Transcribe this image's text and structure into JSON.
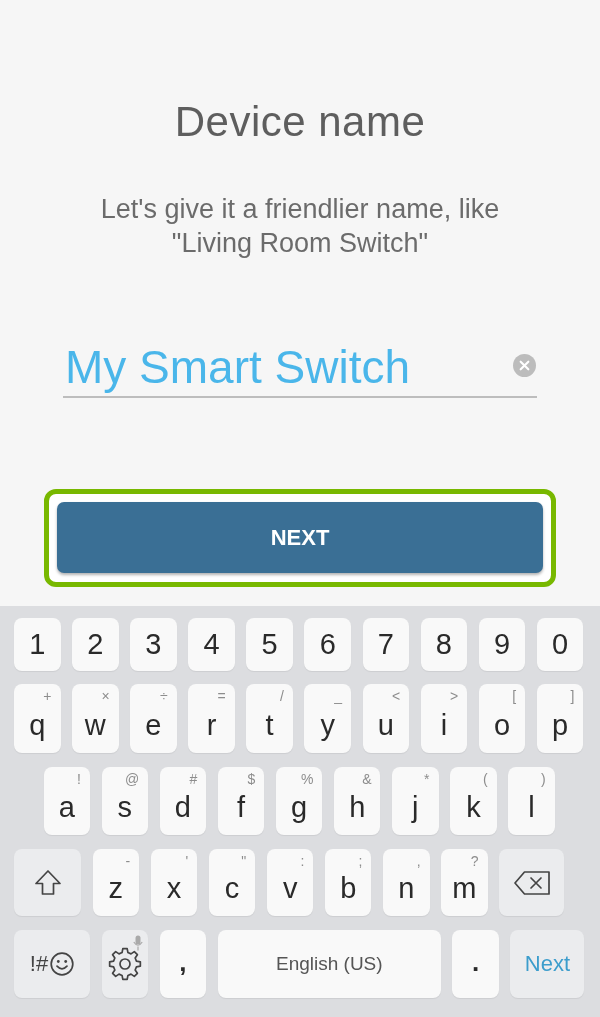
{
  "screen": {
    "title": "Device name",
    "subtitle": "Let's give it a friendlier name, like \"Living Room Switch\""
  },
  "name_field": {
    "value": "My Smart Switch"
  },
  "next_button": {
    "label": "NEXT",
    "highlighted": true
  },
  "keyboard": {
    "rows": [
      {
        "keys": [
          {
            "kind": "char",
            "label": "1"
          },
          {
            "kind": "char",
            "label": "2"
          },
          {
            "kind": "char",
            "label": "3"
          },
          {
            "kind": "char",
            "label": "4"
          },
          {
            "kind": "char",
            "label": "5"
          },
          {
            "kind": "char",
            "label": "6"
          },
          {
            "kind": "char",
            "label": "7"
          },
          {
            "kind": "char",
            "label": "8"
          },
          {
            "kind": "char",
            "label": "9"
          },
          {
            "kind": "char",
            "label": "0"
          }
        ]
      },
      {
        "keys": [
          {
            "kind": "char",
            "label": "q",
            "hint": "+"
          },
          {
            "kind": "char",
            "label": "w",
            "hint": "×"
          },
          {
            "kind": "char",
            "label": "e",
            "hint": "÷"
          },
          {
            "kind": "char",
            "label": "r",
            "hint": "="
          },
          {
            "kind": "char",
            "label": "t",
            "hint": "/"
          },
          {
            "kind": "char",
            "label": "y",
            "hint": "_"
          },
          {
            "kind": "char",
            "label": "u",
            "hint": "<"
          },
          {
            "kind": "char",
            "label": "i",
            "hint": ">"
          },
          {
            "kind": "char",
            "label": "o",
            "hint": "["
          },
          {
            "kind": "char",
            "label": "p",
            "hint": "]"
          }
        ]
      },
      {
        "keys": [
          {
            "kind": "char",
            "label": "a",
            "hint": "!"
          },
          {
            "kind": "char",
            "label": "s",
            "hint": "@"
          },
          {
            "kind": "char",
            "label": "d",
            "hint": "#"
          },
          {
            "kind": "char",
            "label": "f",
            "hint": "$"
          },
          {
            "kind": "char",
            "label": "g",
            "hint": "%"
          },
          {
            "kind": "char",
            "label": "h",
            "hint": "&"
          },
          {
            "kind": "char",
            "label": "j",
            "hint": "*"
          },
          {
            "kind": "char",
            "label": "k",
            "hint": "("
          },
          {
            "kind": "char",
            "label": "l",
            "hint": ")"
          }
        ]
      },
      {
        "keys": [
          {
            "kind": "shift"
          },
          {
            "kind": "char",
            "label": "z",
            "hint": "-"
          },
          {
            "kind": "char",
            "label": "x",
            "hint": "'"
          },
          {
            "kind": "char",
            "label": "c",
            "hint": "\""
          },
          {
            "kind": "char",
            "label": "v",
            "hint": ":"
          },
          {
            "kind": "char",
            "label": "b",
            "hint": ";"
          },
          {
            "kind": "char",
            "label": "n",
            "hint": ","
          },
          {
            "kind": "char",
            "label": "m",
            "hint": "?"
          },
          {
            "kind": "backspace"
          }
        ]
      },
      {
        "keys": [
          {
            "kind": "symbols",
            "label": "!#"
          },
          {
            "kind": "settings"
          },
          {
            "kind": "char",
            "label": ","
          },
          {
            "kind": "space",
            "label": "English (US)"
          },
          {
            "kind": "char",
            "label": "."
          },
          {
            "kind": "action",
            "label": "Next"
          }
        ]
      }
    ]
  }
}
